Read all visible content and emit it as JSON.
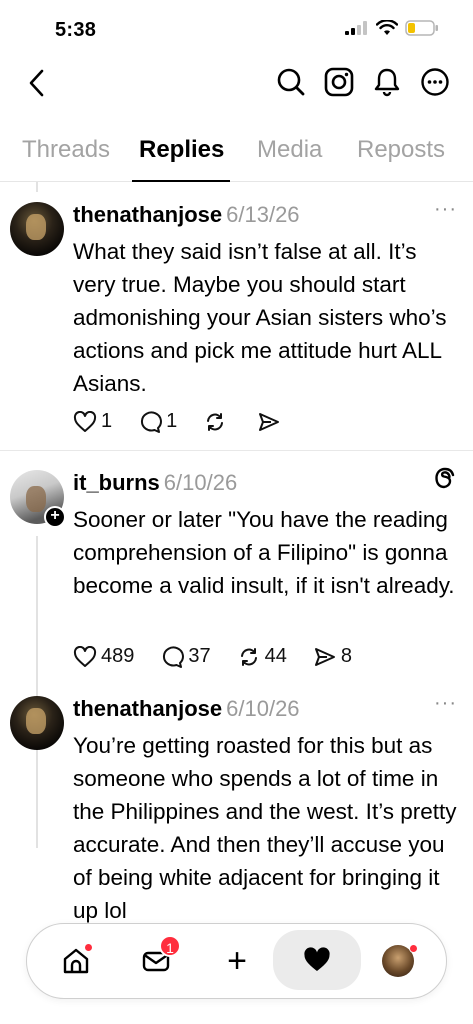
{
  "status": {
    "time": "5:38"
  },
  "tabs": [
    {
      "label": "Threads"
    },
    {
      "label": "Replies"
    },
    {
      "label": "Media"
    },
    {
      "label": "Reposts"
    }
  ],
  "posts": [
    {
      "username": "thenathanjose",
      "date": "6/13/26",
      "more": "···",
      "body": "What they said isn’t false at all. It’s very true. Maybe you should start admonishing your Asian sisters who’s actions and pick me attitude hurt ALL Asians.",
      "likes": "1",
      "replies": "1",
      "reposts": "",
      "shares": ""
    },
    {
      "username": "it_burns",
      "date": "6/10/26",
      "body": "Sooner or later \"You have the reading comprehension of a Filipino\" is gonna become a valid insult, if it isn't already.",
      "likes": "489",
      "replies": "37",
      "reposts": "44",
      "shares": "8"
    },
    {
      "username": "thenathanjose",
      "date": "6/10/26",
      "more": "···",
      "body": "You’re getting roasted for this but as someone who spends a lot of time in the Philippines and the west. It’s pretty accurate. And then they’ll accuse you of being white adjacent for bringing it up lol"
    }
  ],
  "bottom_nav": {
    "messages_badge": "1",
    "plus": "+"
  }
}
